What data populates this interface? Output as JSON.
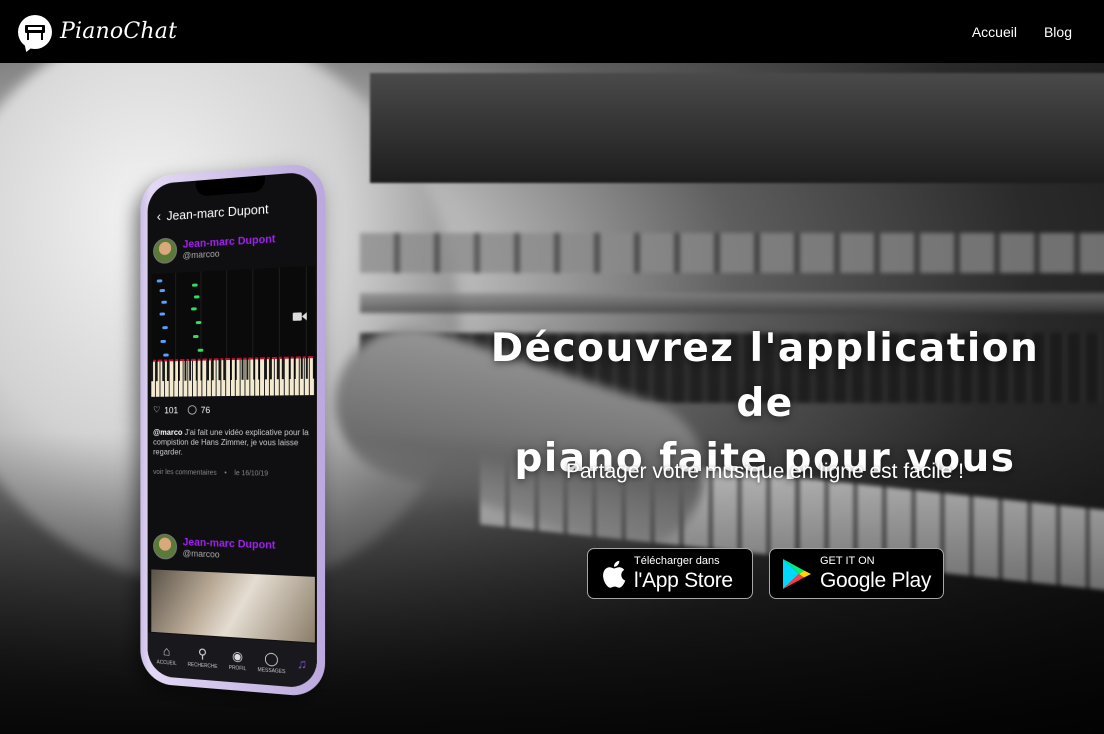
{
  "brand": {
    "name": "PianoChat"
  },
  "nav": {
    "items": [
      {
        "label": "Accueil"
      },
      {
        "label": "Blog"
      }
    ]
  },
  "hero": {
    "title_line1": "Découvrez l'application de",
    "title_line2": "piano faite pour vous",
    "subtitle": "Partager votre musique en ligne est facile !"
  },
  "stores": {
    "apple": {
      "small": "Télécharger dans",
      "big": "l'App Store",
      "icon": "apple-icon"
    },
    "google": {
      "small": "GET IT ON",
      "big": "Google Play",
      "icon": "google-play-icon"
    }
  },
  "phone": {
    "header_title": "Jean-marc Dupont",
    "post1": {
      "name": "Jean-marc Dupont",
      "user": "@marcoo",
      "likes": "101",
      "comments_count": "76",
      "caption_user": "@marco",
      "caption_text": "J'ai fait une vidéo explicative pour la compistion de Hans Zimmer, je vous laisse regarder.",
      "see_comments": "voir les commentaires",
      "date": "le 16/10/19"
    },
    "post2": {
      "name": "Jean-marc Dupont",
      "user": "@marcoo"
    },
    "tabs": [
      {
        "label": "ACCUEIL",
        "icon": "home-icon"
      },
      {
        "label": "RECHERCHE",
        "icon": "search-icon"
      },
      {
        "label": "PROFIL",
        "icon": "profile-icon"
      },
      {
        "label": "MESSAGES",
        "icon": "message-icon"
      },
      {
        "label": "",
        "icon": "piano-app-icon"
      }
    ]
  },
  "colors": {
    "accent_purple": "#a020f0",
    "phone_body": "#cbbde6",
    "background": "#000000"
  }
}
